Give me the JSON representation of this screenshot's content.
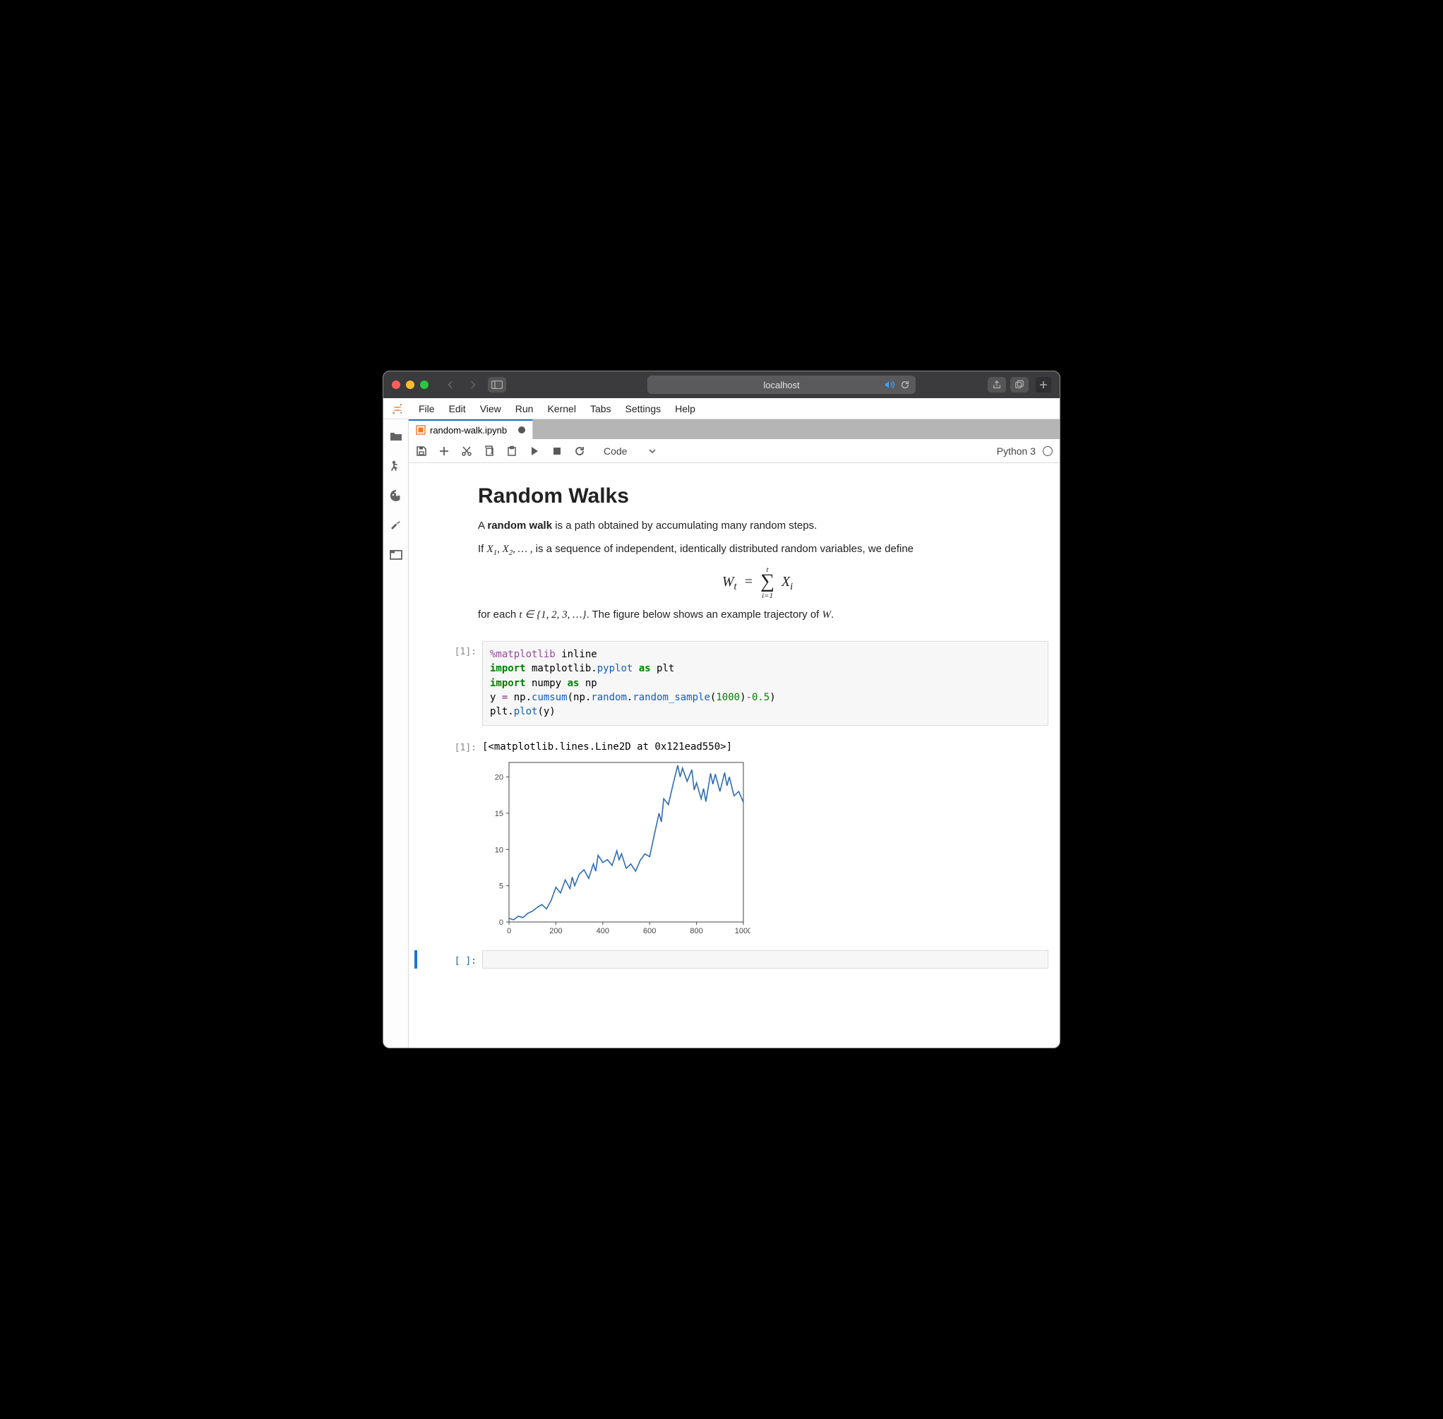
{
  "browser": {
    "url_display": "localhost",
    "traffic_lights": {
      "close": "#ff5f57",
      "min": "#ffbd2e",
      "max": "#28c840"
    }
  },
  "menubar": [
    "File",
    "Edit",
    "View",
    "Run",
    "Kernel",
    "Tabs",
    "Settings",
    "Help"
  ],
  "tab": {
    "filename": "random-walk.ipynb",
    "dirty": true
  },
  "toolbar": {
    "celltype": "Code",
    "kernel_label": "Python 3"
  },
  "notebook": {
    "markdown": {
      "h1": "Random Walks",
      "p1_a": "A ",
      "p1_b": "random walk",
      "p1_c": " is a path obtained by accumulating many random steps.",
      "p2_a": "If ",
      "p2_b": " is a sequence of independent, identically distributed random variables, we define",
      "p3_a": "for each ",
      "p3_b": ". The figure below shows an example trajectory of ",
      "p3_c": "."
    },
    "cell1": {
      "in_prompt": "[1]:",
      "out_prompt": "[1]:",
      "code_lines_raw": [
        "%matplotlib inline",
        "import matplotlib.pyplot as plt",
        "import numpy as np",
        "y = np.cumsum(np.random.random_sample(1000)-0.5)",
        "plt.plot(y)"
      ],
      "out_text": "[<matplotlib.lines.Line2D at 0x121ead550>]"
    },
    "cell2": {
      "in_prompt": "[ ]:"
    }
  },
  "chart_data": {
    "type": "line",
    "xlim": [
      0,
      1000
    ],
    "ylim": [
      0,
      22
    ],
    "xticks": [
      0,
      200,
      400,
      600,
      800,
      1000
    ],
    "yticks": [
      0,
      5,
      10,
      15,
      20
    ],
    "x": [
      0,
      20,
      40,
      60,
      80,
      100,
      120,
      140,
      160,
      180,
      200,
      220,
      240,
      260,
      270,
      280,
      300,
      320,
      340,
      360,
      370,
      380,
      400,
      420,
      440,
      460,
      470,
      480,
      500,
      520,
      540,
      560,
      580,
      600,
      620,
      640,
      650,
      660,
      680,
      700,
      720,
      730,
      740,
      760,
      780,
      790,
      800,
      820,
      830,
      840,
      860,
      870,
      880,
      900,
      920,
      930,
      940,
      960,
      980,
      1000
    ],
    "y": [
      0.5,
      0.3,
      0.8,
      0.6,
      1.2,
      1.5,
      2.0,
      2.4,
      1.8,
      3.0,
      4.8,
      4.0,
      5.8,
      4.6,
      6.2,
      5.0,
      6.6,
      7.2,
      6.0,
      8.0,
      7.0,
      9.2,
      8.2,
      8.6,
      7.8,
      9.8,
      8.6,
      9.4,
      7.4,
      8.0,
      7.0,
      8.5,
      9.4,
      9.0,
      12.0,
      15.0,
      13.8,
      17.0,
      16.2,
      19.0,
      21.6,
      20.0,
      21.2,
      19.4,
      21.0,
      18.2,
      19.2,
      17.0,
      18.4,
      16.6,
      20.5,
      19.0,
      20.4,
      18.0,
      20.6,
      18.8,
      20.0,
      17.4,
      18.0,
      16.5
    ],
    "series_color": "#2e6db3"
  }
}
